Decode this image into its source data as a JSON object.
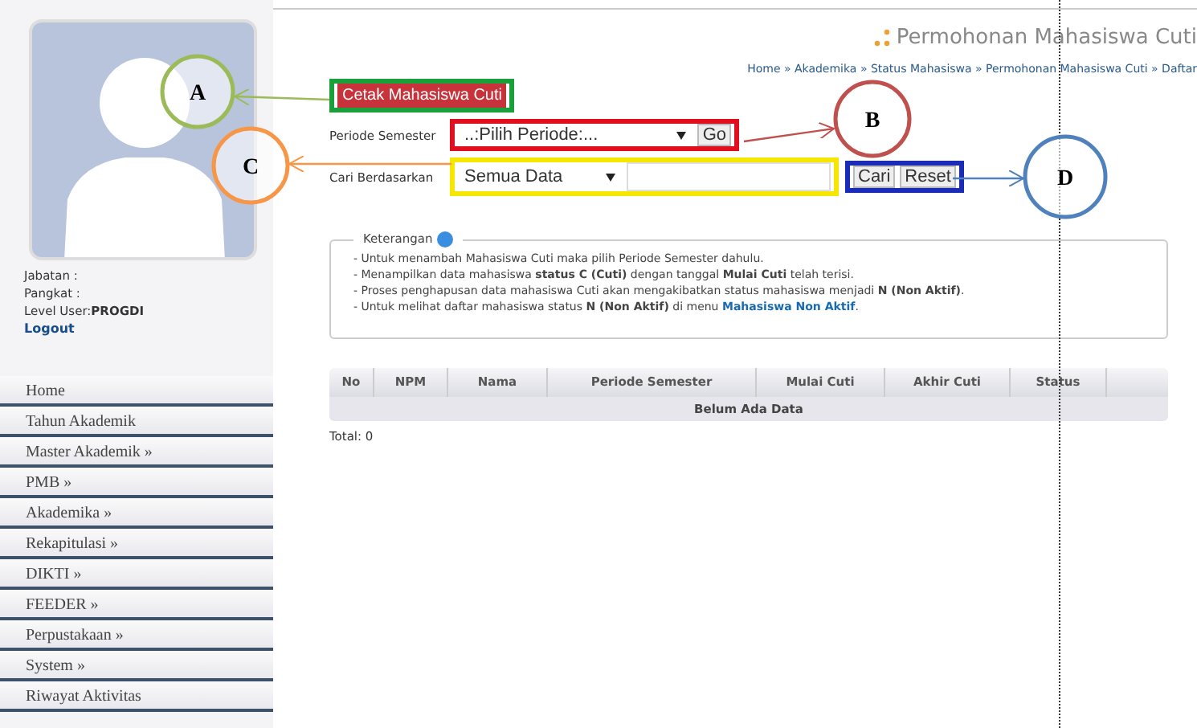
{
  "profile": {
    "fields": [
      {
        "label": "Jabatan :"
      },
      {
        "label": "Pangkat :"
      },
      {
        "label": "Level User:",
        "value": "PROGDI"
      }
    ],
    "logout": "Logout"
  },
  "menu": [
    "Home",
    "Tahun Akademik",
    "Master Akademik »",
    "PMB »",
    "Akademika »",
    "Rekapitulasi »",
    "DIKTI »",
    "FEEDER »",
    "Perpustakaan »",
    "System »",
    "Riwayat Aktivitas"
  ],
  "header": {
    "title": "Permohonan Mahasiswa Cuti",
    "breadcrumb": "Home » Akademika » Status Mahasiswa » Permohonan Mahasiswa Cuti » Daftar"
  },
  "form": {
    "print_button": "Cetak Mahasiswa Cuti",
    "period_label": "Periode Semester",
    "period_select": "..:Pilih Periode:...",
    "go_button": "Go",
    "search_label": "Cari Berdasarkan",
    "search_select": "Semua Data",
    "search_button": "Cari",
    "reset_button": "Reset"
  },
  "info": {
    "legend": "Keterangan",
    "lines": [
      "- Untuk menambah Mahasiswa Cuti maka pilih Periode Semester dahulu.",
      "- Menampilkan data mahasiswa **status C (Cuti)** dengan tanggal **Mulai Cuti** telah terisi.",
      "- Proses penghapusan data mahasiswa Cuti akan mengakibatkan status mahasiswa menjadi **N (Non Aktif)**."
    ],
    "last_line": "- Untuk melihat daftar mahasiswa status **N (Non Aktif)** di menu",
    "link": "Mahasiswa Non Aktif",
    "after_link": "."
  },
  "table": {
    "columns": [
      "No",
      "NPM",
      "Nama",
      "Periode Semester",
      "Mulai Cuti",
      "Akhir Cuti",
      "Status"
    ],
    "empty": "Belum Ada Data",
    "total": "Total: 0"
  },
  "annotations": [
    {
      "letter": "A",
      "color": "#9bbb59"
    },
    {
      "letter": "B",
      "color": "#c0504d"
    },
    {
      "letter": "C",
      "color": "#f79646"
    },
    {
      "letter": "D",
      "color": "#4f81bd"
    }
  ]
}
